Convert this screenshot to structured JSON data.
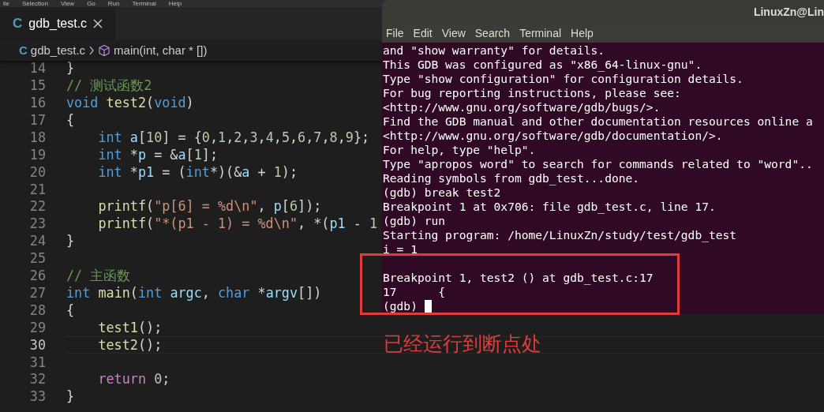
{
  "menu_bar": [
    "ile",
    "Selection",
    "View",
    "Go",
    "Run",
    "Terminal",
    "Help"
  ],
  "tabs": [
    {
      "icon_text": "C",
      "label": "gdb_test.c",
      "selected": true
    }
  ],
  "breadcrumb": {
    "file_icon_text": "C",
    "file": "gdb_test.c",
    "symbol": "main(int, char * [])"
  },
  "code_lines": [
    {
      "number": "14",
      "current": false,
      "indent": false,
      "tokens": [
        {
          "kind": "plain",
          "text": "}"
        }
      ]
    },
    {
      "number": "15",
      "current": false,
      "indent": false,
      "tokens": [
        {
          "kind": "comment",
          "text": "// 测试函数2"
        }
      ]
    },
    {
      "number": "16",
      "current": false,
      "indent": false,
      "tokens": [
        {
          "kind": "keyword",
          "text": "void "
        },
        {
          "kind": "func",
          "text": "test2"
        },
        {
          "kind": "plain",
          "text": "("
        },
        {
          "kind": "keyword",
          "text": "void"
        },
        {
          "kind": "plain",
          "text": ")"
        }
      ]
    },
    {
      "number": "17",
      "current": false,
      "indent": false,
      "tokens": [
        {
          "kind": "plain",
          "text": "{"
        }
      ]
    },
    {
      "number": "18",
      "current": false,
      "indent": true,
      "tokens": [
        {
          "kind": "keyword",
          "text": "int "
        },
        {
          "kind": "var",
          "text": "a"
        },
        {
          "kind": "plain",
          "text": "["
        },
        {
          "kind": "num",
          "text": "10"
        },
        {
          "kind": "plain",
          "text": "] = {"
        },
        {
          "kind": "num",
          "text": "0"
        },
        {
          "kind": "plain",
          "text": ","
        },
        {
          "kind": "num",
          "text": "1"
        },
        {
          "kind": "plain",
          "text": ","
        },
        {
          "kind": "num",
          "text": "2"
        },
        {
          "kind": "plain",
          "text": ","
        },
        {
          "kind": "num",
          "text": "3"
        },
        {
          "kind": "plain",
          "text": ","
        },
        {
          "kind": "num",
          "text": "4"
        },
        {
          "kind": "plain",
          "text": ","
        },
        {
          "kind": "num",
          "text": "5"
        },
        {
          "kind": "plain",
          "text": ","
        },
        {
          "kind": "num",
          "text": "6"
        },
        {
          "kind": "plain",
          "text": ","
        },
        {
          "kind": "num",
          "text": "7"
        },
        {
          "kind": "plain",
          "text": ","
        },
        {
          "kind": "num",
          "text": "8"
        },
        {
          "kind": "plain",
          "text": ","
        },
        {
          "kind": "num",
          "text": "9"
        },
        {
          "kind": "plain",
          "text": "};"
        }
      ]
    },
    {
      "number": "19",
      "current": false,
      "indent": true,
      "tokens": [
        {
          "kind": "keyword",
          "text": "int "
        },
        {
          "kind": "plain",
          "text": "*"
        },
        {
          "kind": "var",
          "text": "p"
        },
        {
          "kind": "plain",
          "text": " = &"
        },
        {
          "kind": "var",
          "text": "a"
        },
        {
          "kind": "plain",
          "text": "["
        },
        {
          "kind": "num",
          "text": "1"
        },
        {
          "kind": "plain",
          "text": "];"
        }
      ]
    },
    {
      "number": "20",
      "current": false,
      "indent": true,
      "tokens": [
        {
          "kind": "keyword",
          "text": "int "
        },
        {
          "kind": "plain",
          "text": "*"
        },
        {
          "kind": "var",
          "text": "p1"
        },
        {
          "kind": "plain",
          "text": " = ("
        },
        {
          "kind": "keyword",
          "text": "int"
        },
        {
          "kind": "plain",
          "text": "*)(&"
        },
        {
          "kind": "var",
          "text": "a"
        },
        {
          "kind": "plain",
          "text": " + "
        },
        {
          "kind": "num",
          "text": "1"
        },
        {
          "kind": "plain",
          "text": ");"
        }
      ]
    },
    {
      "number": "21",
      "current": false
    },
    {
      "number": "22",
      "current": false,
      "indent": true,
      "tokens": [
        {
          "kind": "func",
          "text": "printf"
        },
        {
          "kind": "plain",
          "text": "("
        },
        {
          "kind": "string",
          "text": "\"p[6] = %d\\n\""
        },
        {
          "kind": "plain",
          "text": ", "
        },
        {
          "kind": "var",
          "text": "p"
        },
        {
          "kind": "plain",
          "text": "["
        },
        {
          "kind": "num",
          "text": "6"
        },
        {
          "kind": "plain",
          "text": "]);"
        }
      ]
    },
    {
      "number": "23",
      "current": false,
      "indent": true,
      "tokens": [
        {
          "kind": "func",
          "text": "printf"
        },
        {
          "kind": "plain",
          "text": "("
        },
        {
          "kind": "string",
          "text": "\"*(p1 - 1) = %d\\n\""
        },
        {
          "kind": "plain",
          "text": ", *("
        },
        {
          "kind": "var",
          "text": "p1"
        },
        {
          "kind": "plain",
          "text": " - "
        },
        {
          "kind": "num",
          "text": "1"
        }
      ]
    },
    {
      "number": "24",
      "current": false,
      "indent": false,
      "tokens": [
        {
          "kind": "plain",
          "text": "}"
        }
      ]
    },
    {
      "number": "25",
      "current": false
    },
    {
      "number": "26",
      "current": false,
      "indent": false,
      "tokens": [
        {
          "kind": "comment",
          "text": "// 主函数"
        }
      ]
    },
    {
      "number": "27",
      "current": false,
      "indent": false,
      "tokens": [
        {
          "kind": "keyword",
          "text": "int "
        },
        {
          "kind": "func",
          "text": "main"
        },
        {
          "kind": "plain",
          "text": "("
        },
        {
          "kind": "keyword",
          "text": "int "
        },
        {
          "kind": "var",
          "text": "argc"
        },
        {
          "kind": "plain",
          "text": ", "
        },
        {
          "kind": "keyword",
          "text": "char "
        },
        {
          "kind": "plain",
          "text": "*"
        },
        {
          "kind": "var",
          "text": "argv"
        },
        {
          "kind": "plain",
          "text": "[])"
        }
      ]
    },
    {
      "number": "28",
      "current": false,
      "indent": false,
      "tokens": [
        {
          "kind": "plain",
          "text": "{"
        }
      ]
    },
    {
      "number": "29",
      "current": false,
      "indent": true,
      "tokens": [
        {
          "kind": "func",
          "text": "test1"
        },
        {
          "kind": "plain",
          "text": "();"
        }
      ]
    },
    {
      "number": "30",
      "current": true,
      "indent": true,
      "tokens": [
        {
          "kind": "func",
          "text": "test2"
        },
        {
          "kind": "plain",
          "text": "();"
        }
      ]
    },
    {
      "number": "31",
      "current": false
    },
    {
      "number": "32",
      "current": false,
      "indent": true,
      "tokens": [
        {
          "kind": "control",
          "text": "return "
        },
        {
          "kind": "num",
          "text": "0"
        },
        {
          "kind": "plain",
          "text": ";"
        }
      ]
    },
    {
      "number": "33",
      "current": false,
      "indent": false,
      "tokens": [
        {
          "kind": "plain",
          "text": "}"
        }
      ]
    }
  ],
  "terminal": {
    "title": "LinuxZn@Lin",
    "menu": [
      "File",
      "Edit",
      "View",
      "Search",
      "Terminal",
      "Help"
    ],
    "cursor_visible": true,
    "lines": [
      "and \"show warranty\" for details.",
      "This GDB was configured as \"x86_64-linux-gnu\".",
      "Type \"show configuration\" for configuration details.",
      "For bug reporting instructions, please see:",
      "<http://www.gnu.org/software/gdb/bugs/>.",
      "Find the GDB manual and other documentation resources online a",
      "<http://www.gnu.org/software/gdb/documentation/>.",
      "For help, type \"help\".",
      "Type \"apropos word\" to search for commands related to \"word\"..",
      "Reading symbols from gdb_test...done.",
      "(gdb) break test2",
      "Breakpoint 1 at 0x706: file gdb_test.c, line 17.",
      "(gdb) run",
      "Starting program: /home/LinuxZn/study/test/gdb_test",
      "i = 1"
    ],
    "lines_after_gap": [
      "Breakpoint 1, test2 () at gdb_test.c:17",
      "17      {",
      "(gdb) "
    ]
  },
  "annotation": {
    "text": "已经运行到断点处"
  }
}
